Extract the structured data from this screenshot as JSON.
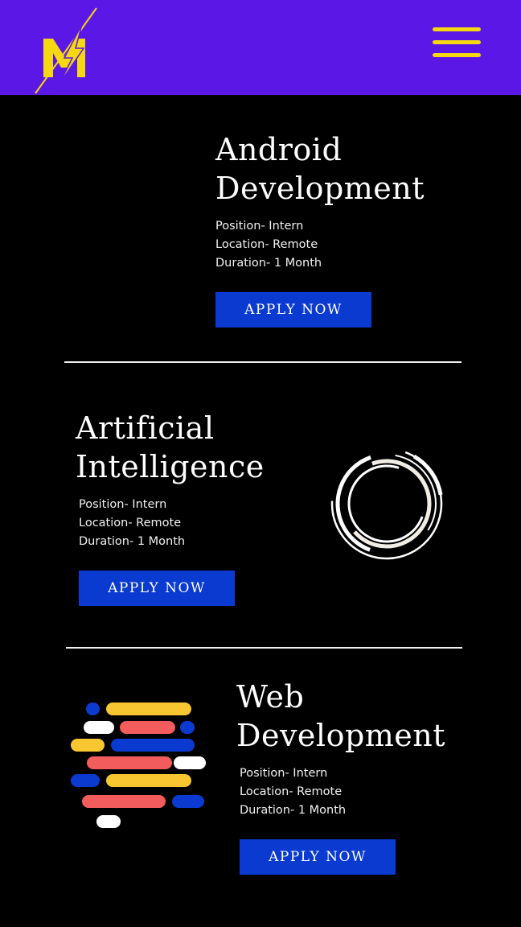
{
  "header": {
    "logo_icon": "lightning-m-logo",
    "menu_icon": "hamburger-menu-icon",
    "colors": {
      "background": "#5b17e6",
      "accent": "#f5d80f"
    }
  },
  "cards": [
    {
      "title_line1": "Android",
      "title_line2": "Development",
      "position": "Position- Intern",
      "location": "Location- Remote",
      "duration": "Duration- 1 Month",
      "button": "APPLY NOW"
    },
    {
      "title_line1": "Artificial",
      "title_line2": "Intelligence",
      "position": "Position- Intern",
      "location": "Location- Remote",
      "duration": "Duration- 1 Month",
      "button": "APPLY NOW",
      "graphic": "concentric-rings-graphic"
    },
    {
      "title_line1": "Web",
      "title_line2": "Development",
      "position": "Position- Intern",
      "location": "Location- Remote",
      "duration": "Duration- 1 Month",
      "button": "APPLY NOW",
      "graphic": "code-lines-graphic"
    }
  ],
  "colors": {
    "button": "#0b3ad0",
    "background": "#000000"
  }
}
